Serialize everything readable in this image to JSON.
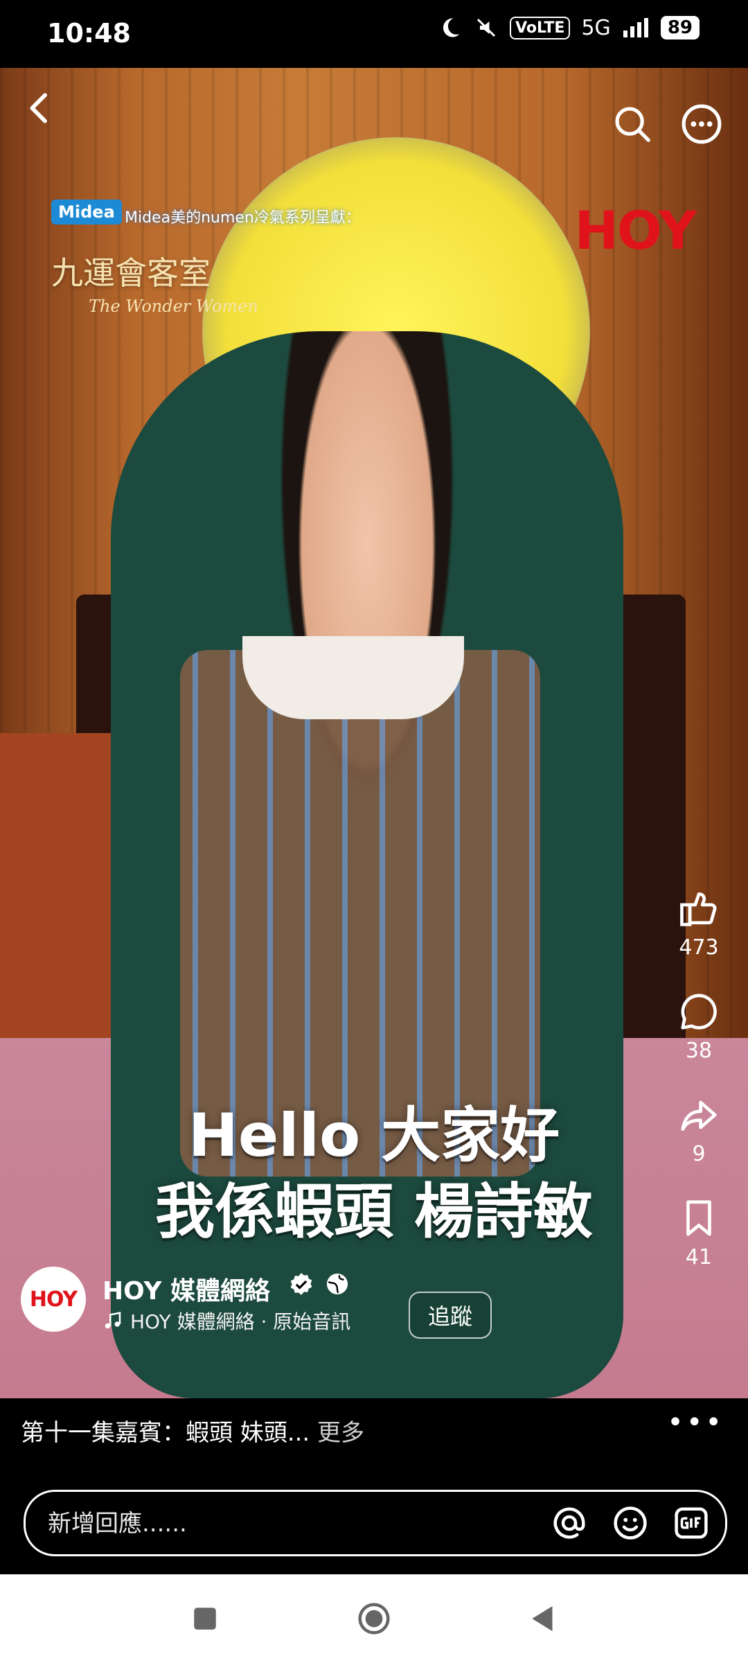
{
  "status_bar": {
    "time": "10:48",
    "network_badge": "VoLTE",
    "network_type": "5G",
    "battery": "89",
    "icons": [
      "moon-icon",
      "mute-icon",
      "signal-icon",
      "battery-icon"
    ]
  },
  "video": {
    "brand_logo_left": "Midea",
    "brand_caption": "Midea美的numen冷氣系列呈獻：",
    "show_title": "九運會客室",
    "show_subtitle": "The Wonder Women",
    "brand_logo_right": "HOY",
    "captions": [
      "Hello 大家好",
      "我係蝦頭 楊詩敏"
    ]
  },
  "actions": {
    "likes": "473",
    "comments": "38",
    "shares": "9",
    "saves": "41"
  },
  "author": {
    "avatar_text": "HOY",
    "name": "HOY 媒體網絡",
    "audio_label": "HOY 媒體網絡 · 原始音訊",
    "follow_label": "追蹤"
  },
  "description": {
    "text": "第十一集嘉賓：蝦頭 妹頭...",
    "more_label": "更多"
  },
  "comment_box": {
    "placeholder": "新增回應......",
    "tools": [
      "at-icon",
      "emoji-icon",
      "gif-icon"
    ]
  },
  "navbar": {
    "icons": [
      "recents-icon",
      "home-icon",
      "back-nav-icon"
    ]
  },
  "colors": {
    "brand_red": "#e0131b",
    "midea_blue": "#1c8ad5"
  }
}
